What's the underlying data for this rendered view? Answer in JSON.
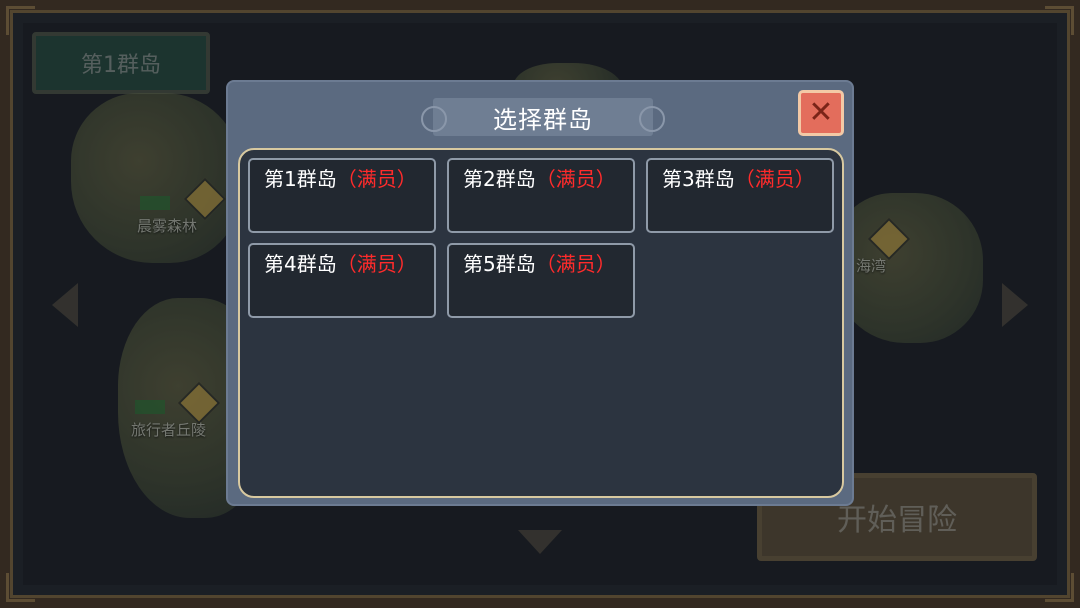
{
  "background": {
    "island_selector": "第1群岛",
    "places": [
      {
        "name": "晨雾森林"
      },
      {
        "name": "旅行者丘陵"
      },
      {
        "name": "海湾"
      }
    ],
    "start_button": "开始冒险"
  },
  "dialog": {
    "title": "选择群岛",
    "close_icon": "close-icon",
    "islands": [
      {
        "name": "第1群岛",
        "status": "（满员）"
      },
      {
        "name": "第2群岛",
        "status": "（满员）"
      },
      {
        "name": "第3群岛",
        "status": "（满员）"
      },
      {
        "name": "第4群岛",
        "status": "（满员）"
      },
      {
        "name": "第5群岛",
        "status": "（满员）"
      }
    ]
  },
  "colors": {
    "status_full": "#ff2b2b",
    "close_button": "#e36d5c",
    "dialog_bg": "#5b6a80",
    "panel_border": "#d8c9a0"
  }
}
